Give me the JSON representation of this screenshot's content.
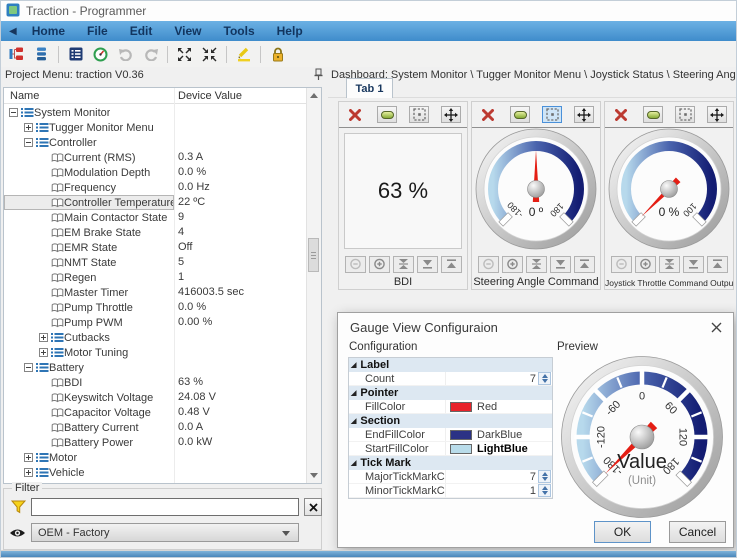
{
  "window": {
    "title": "Traction - Programmer"
  },
  "menu": {
    "items": [
      "Home",
      "File",
      "Edit",
      "View",
      "Tools",
      "Help"
    ]
  },
  "toolbar": {
    "icons": [
      "project-tree-icon",
      "device-stack-icon",
      "parameter-list-icon",
      "monitor-gauge-icon",
      "undo-icon",
      "redo-icon",
      "expand-all-icon",
      "collapse-all-icon",
      "highlighter-icon",
      "lock-icon"
    ]
  },
  "header": {
    "project_label": "Project Menu: traction V0.36",
    "dashboard_path": "Dashboard: System Monitor \\ Tugger Monitor Menu \\ Joystick Status \\ Steering Angle Command"
  },
  "tree": {
    "headers": [
      "Name",
      "Device Value"
    ],
    "rows": [
      {
        "level": 0,
        "type": "branch",
        "expander": "minus",
        "label": "System Monitor",
        "value": ""
      },
      {
        "level": 1,
        "type": "branch",
        "expander": "plus",
        "label": "Tugger Monitor Menu",
        "value": ""
      },
      {
        "level": 1,
        "type": "branch",
        "expander": "minus",
        "label": "Controller",
        "value": ""
      },
      {
        "level": 2,
        "type": "leaf",
        "label": "Current (RMS)",
        "value": "0.3 A"
      },
      {
        "level": 2,
        "type": "leaf",
        "label": "Modulation Depth",
        "value": "0.0 %"
      },
      {
        "level": 2,
        "type": "leaf",
        "label": "Frequency",
        "value": "0.0 Hz"
      },
      {
        "level": 2,
        "type": "leaf",
        "label": "Controller Temperature",
        "value": "22 ºC",
        "selected": true
      },
      {
        "level": 2,
        "type": "leaf",
        "label": "Main Contactor State",
        "value": "9"
      },
      {
        "level": 2,
        "type": "leaf",
        "label": "EM Brake State",
        "value": "4"
      },
      {
        "level": 2,
        "type": "leaf",
        "label": "EMR State",
        "value": "Off"
      },
      {
        "level": 2,
        "type": "leaf",
        "label": "NMT State",
        "value": "5"
      },
      {
        "level": 2,
        "type": "leaf",
        "label": "Regen",
        "value": "1"
      },
      {
        "level": 2,
        "type": "leaf",
        "label": "Master Timer",
        "value": "416003.5 sec"
      },
      {
        "level": 2,
        "type": "leaf",
        "label": "Pump Throttle",
        "value": "0.0 %"
      },
      {
        "level": 2,
        "type": "leaf",
        "label": "Pump PWM",
        "value": "0.00 %"
      },
      {
        "level": 2,
        "type": "branch",
        "expander": "plus",
        "label": "Cutbacks",
        "value": ""
      },
      {
        "level": 2,
        "type": "branch",
        "expander": "plus",
        "label": "Motor Tuning",
        "value": ""
      },
      {
        "level": 1,
        "type": "branch",
        "expander": "minus",
        "label": "Battery",
        "value": ""
      },
      {
        "level": 2,
        "type": "leaf",
        "label": "BDI",
        "value": "63 %"
      },
      {
        "level": 2,
        "type": "leaf",
        "label": "Keyswitch Voltage",
        "value": "24.08 V"
      },
      {
        "level": 2,
        "type": "leaf",
        "label": "Capacitor Voltage",
        "value": "0.48 V"
      },
      {
        "level": 2,
        "type": "leaf",
        "label": "Battery Current",
        "value": "0.0 A"
      },
      {
        "level": 2,
        "type": "leaf",
        "label": "Battery Power",
        "value": "0.0 kW"
      },
      {
        "level": 1,
        "type": "branch",
        "expander": "plus",
        "label": "Motor",
        "value": ""
      },
      {
        "level": 1,
        "type": "branch",
        "expander": "plus",
        "label": "Vehicle",
        "value": ""
      },
      {
        "level": 1,
        "type": "branch",
        "expander": "none",
        "label": "",
        "value": ""
      }
    ]
  },
  "filter": {
    "label": "Filter",
    "input_value": "",
    "profile_value": "OEM - Factory"
  },
  "dashboard": {
    "tab": "Tab 1",
    "panels": [
      {
        "kind": "text",
        "caption": "BDI",
        "display_value": "63 %",
        "config_selected": false
      },
      {
        "kind": "gauge",
        "caption": "Steering Angle Command",
        "config_selected": true,
        "gauge": {
          "min": -180,
          "max": 180,
          "value": 0,
          "center_text": "0 º",
          "labels": [
            {
              "value": -180,
              "text": "-180"
            },
            {
              "value": 180,
              "text": "180"
            }
          ]
        }
      },
      {
        "kind": "gauge",
        "caption": "Joystick Throttle Command Output",
        "config_selected": false,
        "gauge": {
          "min": 0,
          "max": 100,
          "value": 0,
          "center_text": "0 %",
          "labels": [
            {
              "value": 100,
              "text": "100"
            }
          ]
        }
      }
    ]
  },
  "dialog": {
    "title": "Gauge View Configuraion",
    "config_label": "Configuration",
    "preview_label": "Preview",
    "ok_label": "OK",
    "cancel_label": "Cancel",
    "grid": {
      "rows": [
        {
          "type": "group",
          "name": "Label"
        },
        {
          "type": "prop",
          "name": "Count",
          "value": "7",
          "spinner": true
        },
        {
          "type": "group",
          "name": "Pointer"
        },
        {
          "type": "prop",
          "name": "FillColor",
          "value": "Red",
          "swatch": "#e8232a"
        },
        {
          "type": "group",
          "name": "Section"
        },
        {
          "type": "prop",
          "name": "EndFillColor",
          "value": "DarkBlue",
          "swatch": "#2b3285"
        },
        {
          "type": "prop",
          "name": "StartFillColor",
          "value": "LightBlue",
          "swatch": "#b9dcea",
          "bold": true
        },
        {
          "type": "group",
          "name": "Tick Mark"
        },
        {
          "type": "prop",
          "name": "MajorTickMarkCount",
          "value": "7",
          "spinner": true
        },
        {
          "type": "prop",
          "name": "MinorTickMarkCount",
          "value": "1",
          "spinner": true
        }
      ]
    },
    "preview": {
      "min": -180,
      "max": 180,
      "value": -180,
      "center_text": "Value",
      "sub_text": "(Unit)",
      "labels": [
        {
          "value": -180,
          "text": "-180"
        },
        {
          "value": -120,
          "text": "-120"
        },
        {
          "value": -60,
          "text": "-60"
        },
        {
          "value": 0,
          "text": "0"
        },
        {
          "value": 60,
          "text": "60"
        },
        {
          "value": 120,
          "text": "120"
        },
        {
          "value": 180,
          "text": "180"
        }
      ],
      "major_tick_count": 7,
      "minor_tick_count": 1
    }
  },
  "colors": {
    "menu_blue": "#3f8ccb",
    "arc_start": "#b9dcea",
    "arc_end": "#141f7a",
    "needle_red": "#e41e14",
    "pointer_red": "#e8232a"
  }
}
